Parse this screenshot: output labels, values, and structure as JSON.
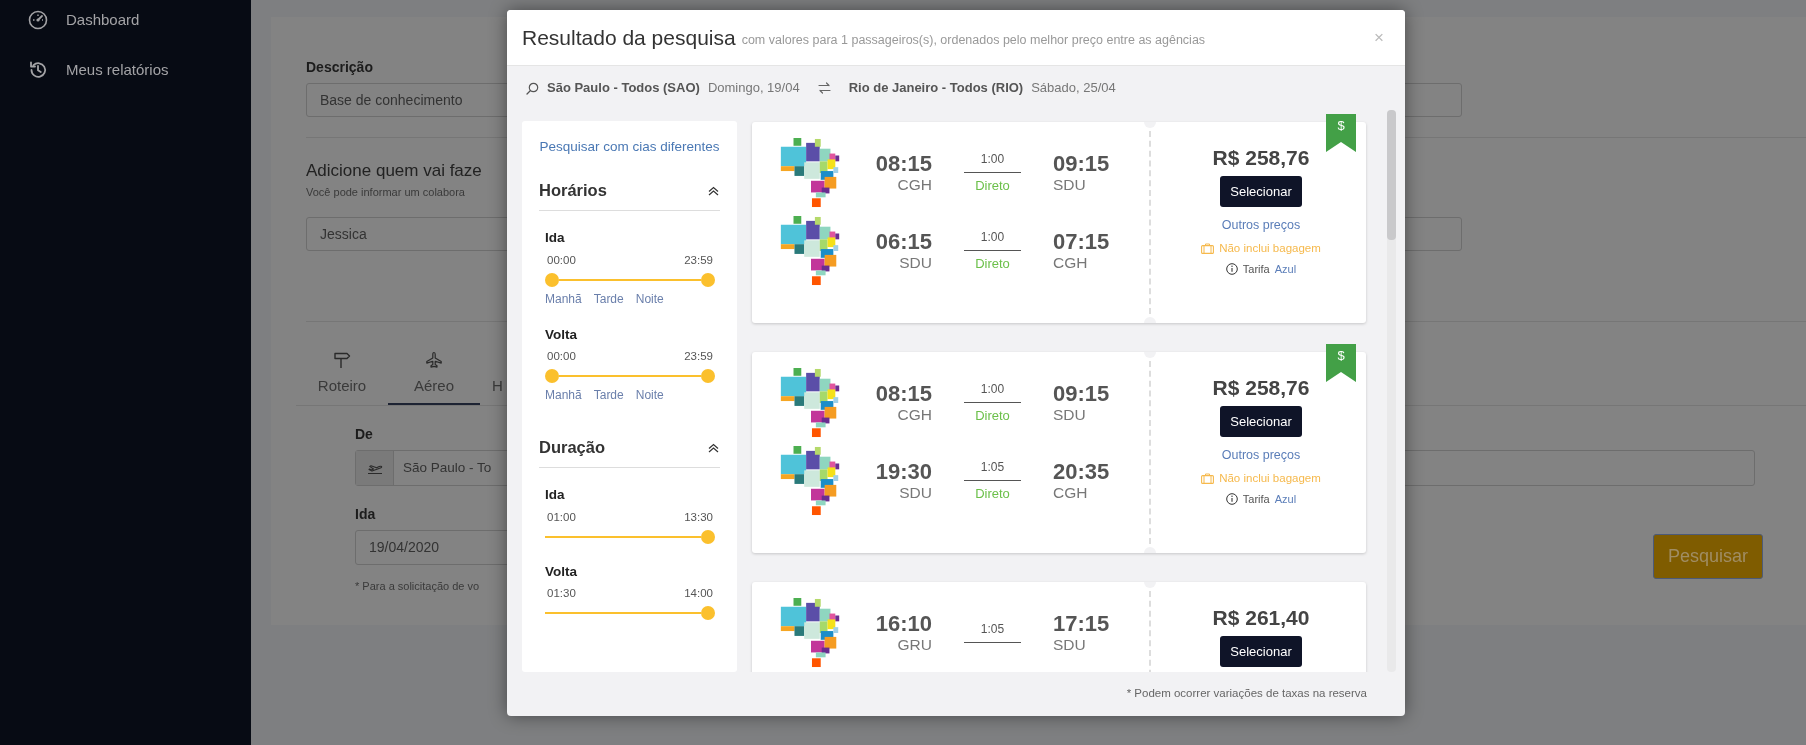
{
  "sidebar": {
    "items": [
      {
        "label": "Dashboard",
        "kind": "gauge"
      },
      {
        "label": "Meus relatórios",
        "kind": "history"
      }
    ]
  },
  "form": {
    "description": {
      "label": "Descrição",
      "value": "Base de conhecimento"
    },
    "traveler": {
      "title": "Adicione quem vai faze",
      "subtitle": "Você pode informar um colabora",
      "value": "Jessica"
    },
    "tabs": [
      {
        "label": "Roteiro",
        "kind": "signpost",
        "selected": false
      },
      {
        "label": "Aéreo",
        "kind": "plane",
        "selected": true
      },
      {
        "label": "H",
        "selected": false
      }
    ],
    "origin": {
      "label": "De",
      "value": "São Paulo - To"
    },
    "departure": {
      "label": "Ida",
      "value": "19/04/2020"
    },
    "note": "* Para a solicitação de vo",
    "search_button": "Pesquisar"
  },
  "modal": {
    "title": "Resultado da pesquisa",
    "subtitle": "com valores para 1 passageiros(s), ordenados pelo melhor preço entre as agências",
    "close": "×",
    "route": {
      "origin": "São Paulo - Todos (SAO)",
      "origin_date": "Domingo, 19/04",
      "destination": "Rio de Janeiro - Todos (RIO)",
      "destination_date": "Sábado, 25/04"
    },
    "filters": {
      "link": "Pesquisar com cias diferentes",
      "sections": [
        {
          "title": "Horários",
          "expanded": true,
          "sliders": [
            {
              "label": "Ida",
              "kind": "range",
              "min": "00:00",
              "max": "23:59",
              "level": 1,
              "periods": [
                "Manhã",
                "Tarde",
                "Noite"
              ]
            },
            {
              "label": "Volta",
              "kind": "range",
              "min": "00:00",
              "max": "23:59",
              "level": 1,
              "periods": [
                "Manhã",
                "Tarde",
                "Noite"
              ]
            }
          ]
        },
        {
          "title": "Duração",
          "expanded": true,
          "sliders": [
            {
              "label": "Ida",
              "kind": "max",
              "min": "01:00",
              "max": "13:30",
              "level": 1
            },
            {
              "label": "Volta",
              "kind": "max",
              "min": "01:30",
              "max": "14:00",
              "level": 1
            }
          ]
        }
      ]
    },
    "results": [
      {
        "price": "R$ 258,76",
        "ribbon": "$",
        "button": "Selecionar",
        "other_prices": "Outros preços",
        "baggage": "Não inclui bagagem",
        "fare_label": "Tarifa",
        "fare": "Azul",
        "legs": [
          {
            "depart": "08:15",
            "from": "CGH",
            "duration": "1:00",
            "stops": "Direto",
            "arrive": "09:15",
            "to": "SDU"
          },
          {
            "depart": "06:15",
            "from": "SDU",
            "duration": "1:00",
            "stops": "Direto",
            "arrive": "07:15",
            "to": "CGH"
          }
        ]
      },
      {
        "price": "R$ 258,76",
        "ribbon": "$",
        "button": "Selecionar",
        "other_prices": "Outros preços",
        "baggage": "Não inclui bagagem",
        "fare_label": "Tarifa",
        "fare": "Azul",
        "legs": [
          {
            "depart": "08:15",
            "from": "CGH",
            "duration": "1:00",
            "stops": "Direto",
            "arrive": "09:15",
            "to": "SDU"
          },
          {
            "depart": "19:30",
            "from": "SDU",
            "duration": "1:05",
            "stops": "Direto",
            "arrive": "20:35",
            "to": "CGH"
          }
        ]
      },
      {
        "price": "R$ 261,40",
        "button": "Selecionar",
        "legs": [
          {
            "depart": "16:10",
            "from": "GRU",
            "duration": "1:05",
            "arrive": "17:15",
            "to": "SDU"
          }
        ]
      }
    ],
    "footer": "* Podem ocorrer variações de taxas na reserva"
  }
}
